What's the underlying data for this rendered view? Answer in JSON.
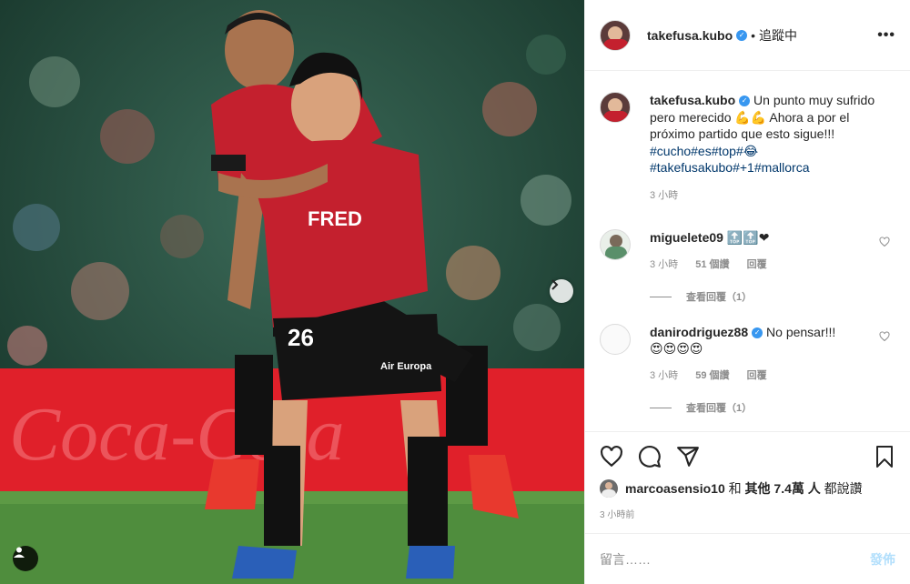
{
  "header": {
    "username": "takefusa.kubo",
    "separator": "•",
    "follow_status": "追蹤中",
    "more_label": "•••"
  },
  "photo": {
    "banner_text": "Coca-Cola",
    "shirt_sponsor": "FRED",
    "shirt_number": "26",
    "sleeve_sponsor": "Air Europa"
  },
  "caption": {
    "username": "takefusa.kubo",
    "text": "Un punto muy sufrido pero merecido 💪💪 Ahora a por el próximo partido que esto sigue!!!",
    "hashtags_line1": "#cucho#es#top#😂",
    "hashtags_line2": "#takefusakubo#+1#mallorca",
    "time": "3 小時"
  },
  "comments": [
    {
      "username": "miguelete09",
      "text": "🔝🔝❤",
      "time": "3 小時",
      "likes": "51 個讚",
      "reply": "回覆",
      "view_replies": "查看回覆（1）"
    },
    {
      "username": "danirodriguez88",
      "text": "No pensar!!!",
      "emojis": "😍😍😍😍",
      "time": "3 小時",
      "likes": "59 個讚",
      "reply": "回覆",
      "view_replies": "查看回覆（1）"
    }
  ],
  "likes": {
    "user": "marcoasensio10",
    "middle": " 和 ",
    "others": "其他 7.4萬 人",
    "suffix": " 都說讚"
  },
  "post_time": "3 小時前",
  "add_comment": {
    "placeholder": "留言……",
    "post_label": "發佈"
  },
  "colors": {
    "accent": "#3897f0",
    "hashtag": "#00376b",
    "muted": "#8e8e8e",
    "post_disabled": "#b2dffc",
    "jersey_red": "#c4202e"
  }
}
